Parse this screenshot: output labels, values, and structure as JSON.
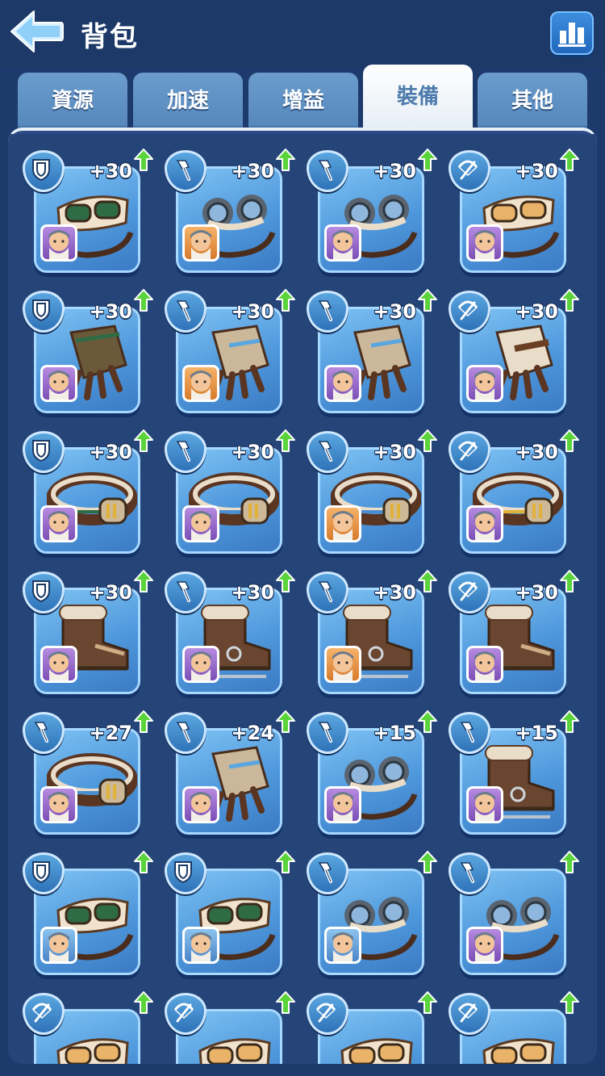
{
  "header": {
    "title": "背包"
  },
  "tabs": [
    {
      "label": "資源",
      "active": false
    },
    {
      "label": "加速",
      "active": false
    },
    {
      "label": "增益",
      "active": false
    },
    {
      "label": "裝備",
      "active": true
    },
    {
      "label": "其他",
      "active": false
    }
  ],
  "colors": {
    "background": "#1d3a6c",
    "card": "#5fa8e6",
    "active_tab": "#ffffff",
    "upgrade_arrow": "#5bd43c"
  },
  "items": [
    {
      "type": "shield-icon",
      "piece": "goggles-green",
      "bonus": "+30",
      "hero_frame": "purple"
    },
    {
      "type": "pickaxe-icon",
      "piece": "goggles-blue",
      "bonus": "+30",
      "hero_frame": "orange"
    },
    {
      "type": "pickaxe-icon",
      "piece": "goggles-blue",
      "bonus": "+30",
      "hero_frame": "purple"
    },
    {
      "type": "crossbow-icon",
      "piece": "goggles-amber",
      "bonus": "+30",
      "hero_frame": "purple"
    },
    {
      "type": "shield-icon",
      "piece": "gloves-green",
      "bonus": "+30",
      "hero_frame": "purple"
    },
    {
      "type": "pickaxe-icon",
      "piece": "gloves-metal",
      "bonus": "+30",
      "hero_frame": "orange"
    },
    {
      "type": "pickaxe-icon",
      "piece": "gloves-metal",
      "bonus": "+30",
      "hero_frame": "purple"
    },
    {
      "type": "crossbow-icon",
      "piece": "gloves-fur",
      "bonus": "+30",
      "hero_frame": "purple"
    },
    {
      "type": "shield-icon",
      "piece": "belt-green",
      "bonus": "+30",
      "hero_frame": "purple"
    },
    {
      "type": "pickaxe-icon",
      "piece": "belt-blue",
      "bonus": "+30",
      "hero_frame": "purple"
    },
    {
      "type": "pickaxe-icon",
      "piece": "belt-blue",
      "bonus": "+30",
      "hero_frame": "orange"
    },
    {
      "type": "crossbow-icon",
      "piece": "belt-gold",
      "bonus": "+30",
      "hero_frame": "purple"
    },
    {
      "type": "shield-icon",
      "piece": "boots-fur",
      "bonus": "+30",
      "hero_frame": "purple"
    },
    {
      "type": "pickaxe-icon",
      "piece": "boots-skate",
      "bonus": "+30",
      "hero_frame": "purple"
    },
    {
      "type": "pickaxe-icon",
      "piece": "boots-skate",
      "bonus": "+30",
      "hero_frame": "orange"
    },
    {
      "type": "crossbow-icon",
      "piece": "boots-fur",
      "bonus": "+30",
      "hero_frame": "purple"
    },
    {
      "type": "pickaxe-icon",
      "piece": "belt-blue",
      "bonus": "+27",
      "hero_frame": "purple"
    },
    {
      "type": "pickaxe-icon",
      "piece": "gloves-metal",
      "bonus": "+24",
      "hero_frame": "purple"
    },
    {
      "type": "pickaxe-icon",
      "piece": "goggles-blue",
      "bonus": "+15",
      "hero_frame": "purple"
    },
    {
      "type": "pickaxe-icon",
      "piece": "boots-skate",
      "bonus": "+15",
      "hero_frame": "purple"
    },
    {
      "type": "shield-icon",
      "piece": "goggles-green",
      "bonus": "",
      "hero_frame": "blue"
    },
    {
      "type": "shield-icon",
      "piece": "goggles-green",
      "bonus": "",
      "hero_frame": "blue"
    },
    {
      "type": "pickaxe-icon",
      "piece": "goggles-blue",
      "bonus": "",
      "hero_frame": "blue"
    },
    {
      "type": "pickaxe-icon",
      "piece": "goggles-blue",
      "bonus": "",
      "hero_frame": "purple"
    },
    {
      "type": "crossbow-icon",
      "piece": "goggles-amber",
      "bonus": "",
      "hero_frame": ""
    },
    {
      "type": "crossbow-icon",
      "piece": "goggles-amber",
      "bonus": "",
      "hero_frame": ""
    },
    {
      "type": "crossbow-icon",
      "piece": "goggles-amber",
      "bonus": "",
      "hero_frame": ""
    },
    {
      "type": "crossbow-icon",
      "piece": "goggles-amber",
      "bonus": "",
      "hero_frame": ""
    }
  ]
}
